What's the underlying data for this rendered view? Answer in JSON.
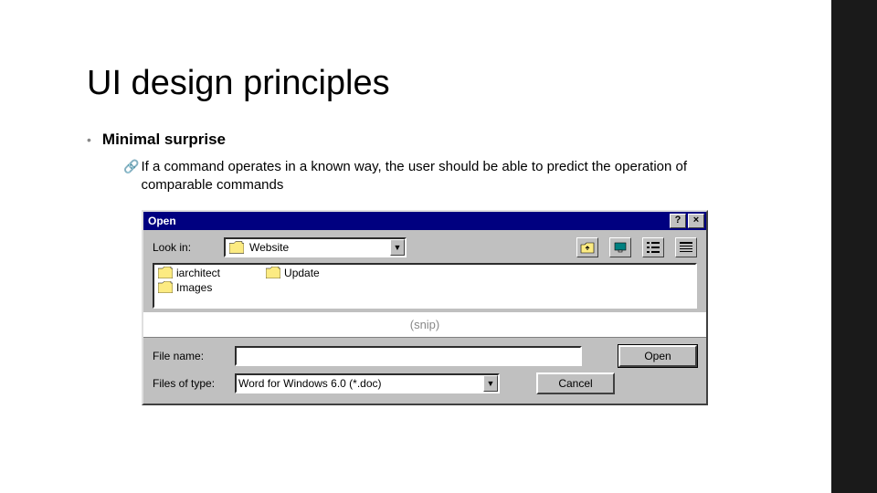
{
  "slide": {
    "title": "UI design principles",
    "bullet": "Minimal surprise",
    "subtext": "If a command operates in a known way, the user should be able to predict the operation of comparable commands"
  },
  "dialog": {
    "title": "Open",
    "lookin_label": "Look in:",
    "lookin_value": "Website",
    "files": {
      "col1": [
        "iarchitect",
        "Images"
      ],
      "col2": [
        "Update"
      ]
    },
    "snip": "(snip)",
    "filename_label": "File name:",
    "filename_value": "",
    "filetype_label": "Files of type:",
    "filetype_value": "Word for Windows 6.0 (*.doc)",
    "open_btn": "Open",
    "cancel_btn": "Cancel",
    "help_btn": "?",
    "close_btn": "×"
  }
}
